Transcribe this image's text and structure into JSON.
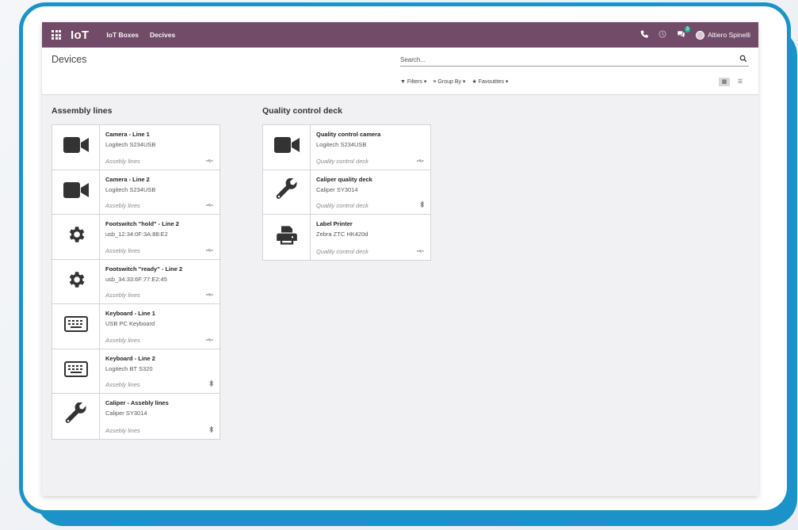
{
  "topbar": {
    "brand": "IoT",
    "menu": [
      "IoT Boxes",
      "Decives"
    ],
    "user": "Altiero Spinelli",
    "chat_badge": "3"
  },
  "control": {
    "title": "Devices",
    "search_placeholder": "Search...",
    "filters": [
      "▼ Filters ▾",
      "≡ Group By ▾",
      "★ Favoutites ▾"
    ]
  },
  "groups": [
    {
      "title": "Assembly lines",
      "devices": [
        {
          "name": "Camera - Line 1",
          "model": "Logitech S234USB",
          "location": "Assebly lines",
          "icon": "camera-icon",
          "connection": "usb"
        },
        {
          "name": "Camera - Line 2",
          "model": "Logitech S234USB",
          "location": "Assebly lines",
          "icon": "camera-icon",
          "connection": "usb"
        },
        {
          "name": "Footswitch \"hold\" - Line 2",
          "model": "usb_12:34:0F:3A:88:E2",
          "location": "Assebly lines",
          "icon": "gear-icon",
          "connection": "usb"
        },
        {
          "name": "Footswitch \"ready\" - Line 2",
          "model": "usb_34:33:6F:77:E2:45",
          "location": "Assebly lines",
          "icon": "gear-icon",
          "connection": "usb"
        },
        {
          "name": "Keyboard - Line 1",
          "model": "USB PC Keyboard",
          "location": "Assebly lines",
          "icon": "keyboard-icon",
          "connection": "usb"
        },
        {
          "name": "Keyboard - Line 2",
          "model": "Logitech BT S320",
          "location": "Assebly lines",
          "icon": "keyboard-icon",
          "connection": "bluetooth"
        },
        {
          "name": "Caliper - Assebly lines",
          "model": "Caliper SY3014",
          "location": "Assebly lines",
          "icon": "wrench-icon",
          "connection": "bluetooth"
        }
      ]
    },
    {
      "title": "Quality control deck",
      "devices": [
        {
          "name": "Quality control camera",
          "model": "Logitech S234USB",
          "location": "Quality control deck",
          "icon": "camera-icon",
          "connection": "usb"
        },
        {
          "name": "Caliper quality deck",
          "model": "Caliper SY3014",
          "location": "Quality control deck",
          "icon": "wrench-icon",
          "connection": "bluetooth"
        },
        {
          "name": "Label Printer",
          "model": "Zebra ZTC HK420d",
          "location": "Quality control deck",
          "icon": "printer-icon",
          "connection": "usb"
        }
      ]
    }
  ],
  "colors": {
    "topbar": "#714b67",
    "frame": "#1b93c8",
    "icon": "#333333"
  }
}
